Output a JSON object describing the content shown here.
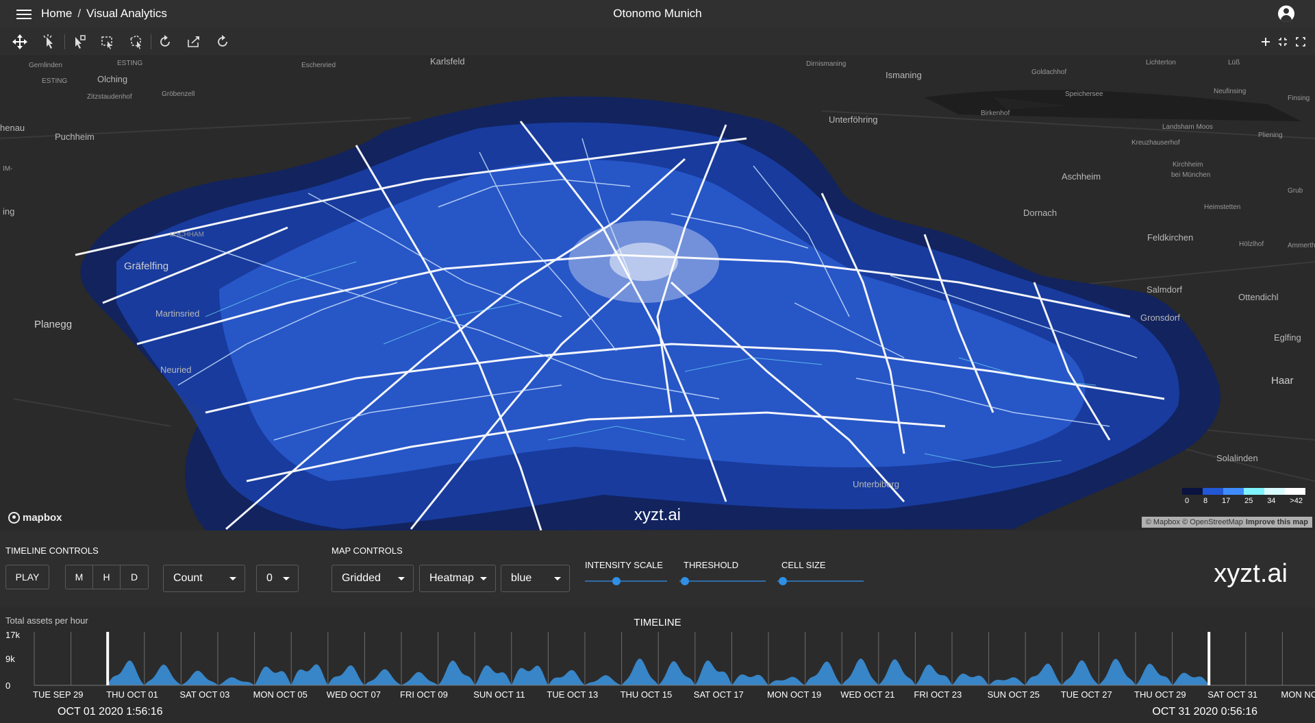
{
  "header": {
    "breadcrumb_home": "Home",
    "breadcrumb_sep": "/",
    "breadcrumb_current": "Visual Analytics",
    "title": "Otonomo Munich"
  },
  "map": {
    "places": [
      {
        "name": "Karlsfeld",
        "size": "normal"
      },
      {
        "name": "Gernlinden",
        "size": "small"
      },
      {
        "name": "ESTING",
        "size": "small"
      },
      {
        "name": "ESTING",
        "size": "small"
      },
      {
        "name": "Olching",
        "size": "normal"
      },
      {
        "name": "Eschenried",
        "size": "small"
      },
      {
        "name": "Zitzstaudenhof",
        "size": "small"
      },
      {
        "name": "Gröbenzell",
        "size": "small"
      },
      {
        "name": "henau",
        "size": "normal"
      },
      {
        "name": "Puchheim",
        "size": "normal"
      },
      {
        "name": "IM-",
        "size": "small"
      },
      {
        "name": "ing",
        "size": "normal"
      },
      {
        "name": "LOCHHAM",
        "size": "small"
      },
      {
        "name": "Gräfelfing",
        "size": "big"
      },
      {
        "name": "Martinsried",
        "size": "normal"
      },
      {
        "name": "Planegg",
        "size": "big"
      },
      {
        "name": "Neuried",
        "size": "normal"
      },
      {
        "name": "Dirnismaning",
        "size": "small"
      },
      {
        "name": "Ismaning",
        "size": "normal"
      },
      {
        "name": "Goldachhof",
        "size": "small"
      },
      {
        "name": "Lüß",
        "size": "small"
      },
      {
        "name": "Neufinsing",
        "size": "small"
      },
      {
        "name": "Finsing",
        "size": "small"
      },
      {
        "name": "Speichersee",
        "size": "small"
      },
      {
        "name": "Birkenhof",
        "size": "small"
      },
      {
        "name": "Unterföhring",
        "size": "normal"
      },
      {
        "name": "Landsham Moos",
        "size": "small"
      },
      {
        "name": "Pliening",
        "size": "small"
      },
      {
        "name": "Kreuzhauserhof",
        "size": "small"
      },
      {
        "name": "Aschheim",
        "size": "normal"
      },
      {
        "name": "Kirchheim",
        "size": "small"
      },
      {
        "name": "bei München",
        "size": "small"
      },
      {
        "name": "Grub",
        "size": "small"
      },
      {
        "name": "Dornach",
        "size": "normal"
      },
      {
        "name": "Heimstetten",
        "size": "small"
      },
      {
        "name": "Feldkirchen",
        "size": "normal"
      },
      {
        "name": "Hölzlhof",
        "size": "small"
      },
      {
        "name": "Ammertha",
        "size": "small"
      },
      {
        "name": "Salmdorf",
        "size": "normal"
      },
      {
        "name": "Ottendichl",
        "size": "normal"
      },
      {
        "name": "Gronsdorf",
        "size": "normal"
      },
      {
        "name": "Eglfing",
        "size": "normal"
      },
      {
        "name": "Haar",
        "size": "big"
      },
      {
        "name": "Solalinden",
        "size": "normal"
      },
      {
        "name": "Unterbiberg",
        "size": "normal"
      },
      {
        "name": "Lichterton",
        "size": "small"
      }
    ],
    "mapbox_label": "mapbox",
    "watermark": "xyzt.ai",
    "attribution": "© Mapbox © OpenStreetMap",
    "attribution_link": "Improve this map",
    "legend": {
      "labels": [
        "0",
        "8",
        "17",
        "25",
        "34",
        ">42"
      ],
      "colors": [
        "#0a1240",
        "#2257d6",
        "#3f8cff",
        "#7ff3ff",
        "#d9fbff",
        "#ffffff"
      ]
    }
  },
  "controls": {
    "timeline_label": "TIMELINE CONTROLS",
    "play_label": "PLAY",
    "granularity": [
      "M",
      "H",
      "D"
    ],
    "aggregate_value": "Count",
    "offset_value": "0",
    "map_label": "MAP CONTROLS",
    "mode_value": "Gridded",
    "style_value": "Heatmap",
    "color_value": "blue",
    "intensity_label": "INTENSITY SCALE",
    "threshold_label": "THRESHOLD",
    "cellsize_label": "CELL SIZE",
    "intensity_level": 0.37,
    "threshold_level": 0.02,
    "cellsize_level": 0.02,
    "brand": "xyzt.ai"
  },
  "timeline": {
    "subtitle": "Total assets per hour",
    "title": "TIMELINE",
    "start_date": "OCT 01 2020 1:56:16",
    "end_date": "OCT 31 2020 0:56:16"
  },
  "chart_data": {
    "type": "area",
    "y_ticks": [
      "17k",
      "9k",
      "0"
    ],
    "ylim": [
      0,
      17000
    ],
    "x_labels": [
      "TUE SEP 29",
      "THU OCT 01",
      "SAT OCT 03",
      "MON OCT 05",
      "WED OCT 07",
      "FRI OCT 09",
      "SUN OCT 11",
      "TUE OCT 13",
      "THU OCT 15",
      "SAT OCT 17",
      "MON OCT 19",
      "WED OCT 21",
      "FRI OCT 23",
      "SUN OCT 25",
      "TUE OCT 27",
      "THU OCT 29",
      "SAT OCT 31",
      "MON NO"
    ],
    "day_start": 2,
    "day_end": 32,
    "daily_peaks": [
      9000,
      7000,
      5000,
      3000,
      8500,
      9500,
      7500,
      5500,
      4500,
      9000,
      8500,
      9500,
      6000,
      3500,
      9000,
      8500,
      10000,
      5500,
      3500,
      8500,
      9000,
      9000,
      8000,
      5500,
      3500,
      8000,
      8500,
      9000,
      8000,
      5500
    ],
    "selection_start": "OCT 01 2020 1:56:16",
    "selection_end": "OCT 31 2020 0:56:16",
    "color": "#3a8fd8"
  }
}
